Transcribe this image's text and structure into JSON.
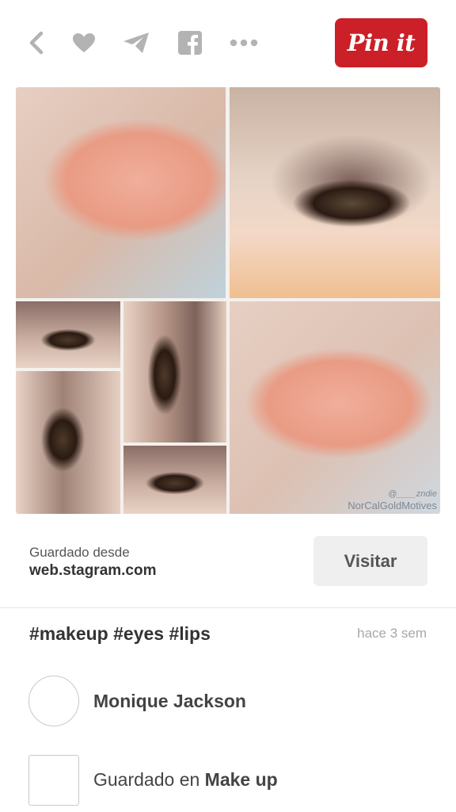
{
  "toolbar": {
    "icons": [
      "back-icon",
      "heart-icon",
      "send-icon",
      "facebook-icon",
      "more-icon"
    ],
    "pin_label": "Pin it",
    "pin_color": "#cb2027"
  },
  "pin_image": {
    "tiles": [
      "lips",
      "eye",
      "eye",
      "eye",
      "eye",
      "eye",
      "lips"
    ],
    "watermark_handle": "@____zndie",
    "watermark_brand": "NorCalGoldMotives"
  },
  "source": {
    "label": "Guardado desde",
    "domain": "web.stagram.com",
    "visit_label": "Visitar"
  },
  "pin": {
    "description": "#makeup #eyes #lips",
    "time_ago": "hace 3 sem"
  },
  "user": {
    "name": "Monique Jackson"
  },
  "board": {
    "prefix": "Guardado en",
    "name": "Make up"
  },
  "colors": {
    "accent": "#cb2027",
    "icon_gray": "#b3b3b3",
    "text_dark": "#333333",
    "button_gray": "#efefef"
  }
}
